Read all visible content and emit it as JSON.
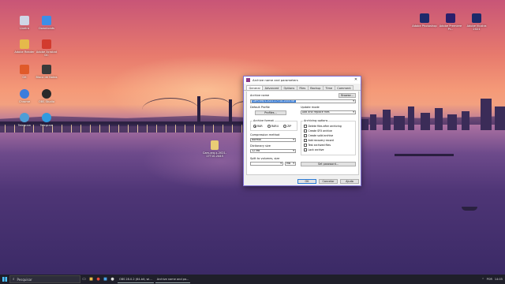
{
  "desktop": {
    "icons_left": [
      {
        "label": "Lixeira",
        "icon": "recycle-bin-icon",
        "color": "#cfd6e6"
      },
      {
        "label": "Downloads",
        "icon": "download-icon",
        "color": "#3c8ee6"
      },
      {
        "label": "Adobe Acrobat DC",
        "icon": "acrobat-icon",
        "color": "#d23b2e"
      },
      {
        "label": "Adobe Reader",
        "icon": "folder-icon",
        "color": "#e5b94b"
      },
      {
        "label": "Bloco de Notas",
        "icon": "notepad-icon",
        "color": "#3a3a3a"
      },
      {
        "label": "Git",
        "icon": "app-icon",
        "color": "#e05a2a"
      },
      {
        "label": "OBS Studio",
        "icon": "obs-icon",
        "color": "#2a2a2a"
      },
      {
        "label": "Chrome",
        "icon": "chrome-icon",
        "color": "#3b7ddd"
      },
      {
        "label": "Telegram",
        "icon": "telegram-icon",
        "color": "#2f9be0"
      }
    ],
    "icons_right": [
      {
        "label": "Adobe Photoshop",
        "icon": "photoshop-icon",
        "color": "#1e2a6b"
      },
      {
        "label": "Adobe Premiere Pr...",
        "icon": "premiere-icon",
        "color": "#2a1f6b"
      },
      {
        "label": "Adobe Illustra 2021",
        "icon": "after-effects-icon",
        "color": "#1c2a6a"
      }
    ],
    "file_icon": {
      "label": "Cam-arq-s-2021-17T10-2445",
      "icon": "zip-file-icon",
      "color": "#e9cc75"
    }
  },
  "dialog": {
    "title": "Archive name and parameters",
    "close": "✕",
    "tabs": [
      "General",
      "Advanced",
      "Options",
      "Files",
      "Backup",
      "Time",
      "Comment"
    ],
    "active_tab": "General",
    "archive_name_label": "Archive name",
    "browse_button": "Browse...",
    "archive_name_value": "Cam-arq-s-2021-17T10-2445.rar",
    "default_profile_label": "Default Profile",
    "profiles_button": "Profiles...",
    "update_mode_label": "Update mode",
    "update_mode_value": "Add and replace files",
    "archive_format_label": "Archive format",
    "formats": [
      "RAR",
      "RAR4",
      "ZIP"
    ],
    "selected_format": "RAR",
    "archiving_options_label": "Archiving options",
    "options": [
      "Delete files after archiving",
      "Create SFX archive",
      "Create solid archive",
      "Add recovery record",
      "Test archived files",
      "Lock archive"
    ],
    "compression_label": "Compression method",
    "compression_value": "Normal",
    "dict_label": "Dictionary size",
    "dict_value": "32 MB",
    "split_label": "Split to volumes, size",
    "split_unit": "MB",
    "set_password_button": "Set password...",
    "ok": "OK",
    "cancel": "Cancelar",
    "help": "Ajuda"
  },
  "taskbar": {
    "search_placeholder": "Pesquisar",
    "apps": [
      "OBS 28.0.2 (64-bit, wi...",
      "Archive name and pa..."
    ],
    "tray_lang": "POR",
    "clock": "14:05"
  },
  "colors": {
    "dialog_border": "#7f6fd4",
    "taskbar": "#1f1f2a",
    "accent": "#2b7bd6"
  }
}
